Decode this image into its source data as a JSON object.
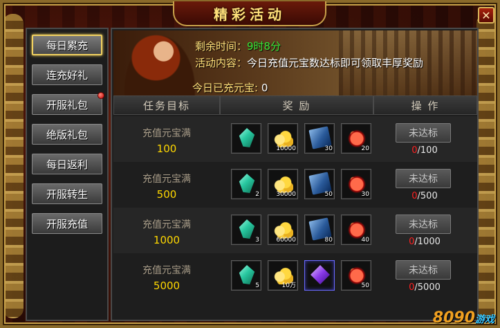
{
  "window": {
    "title": "精彩活动",
    "close_label": "✕"
  },
  "sidebar": {
    "items": [
      {
        "label": "每日累充",
        "active": true,
        "badge": false
      },
      {
        "label": "连充好礼",
        "active": false,
        "badge": false
      },
      {
        "label": "开服礼包",
        "active": false,
        "badge": true
      },
      {
        "label": "绝版礼包",
        "active": false,
        "badge": false
      },
      {
        "label": "每日返利",
        "active": false,
        "badge": false
      },
      {
        "label": "开服转生",
        "active": false,
        "badge": false
      },
      {
        "label": "开服充值",
        "active": false,
        "badge": false
      }
    ]
  },
  "banner": {
    "time_label": "剩余时间：",
    "time_value": "9时8分",
    "content_label": "活动内容：",
    "content_value": "今日充值元宝数达标即可领取丰厚奖励",
    "today_label": "今日已充元宝:",
    "today_value": "0"
  },
  "table": {
    "headers": {
      "target": "任务目标",
      "reward": "奖 励",
      "action": "操 作"
    },
    "rows": [
      {
        "cond": "充值元宝满",
        "amount": "100",
        "items": [
          {
            "icon": "crystal-icon",
            "qty": ""
          },
          {
            "icon": "gold-icon",
            "qty": "10000"
          },
          {
            "icon": "book-icon",
            "qty": "30"
          },
          {
            "icon": "ruby-icon",
            "qty": "20"
          }
        ],
        "button": "未达标",
        "cur": "0",
        "goal": "/100"
      },
      {
        "cond": "充值元宝满",
        "amount": "500",
        "items": [
          {
            "icon": "crystal-icon",
            "qty": "2"
          },
          {
            "icon": "gold-icon",
            "qty": "30000"
          },
          {
            "icon": "book-icon",
            "qty": "50"
          },
          {
            "icon": "ruby-icon",
            "qty": "30"
          }
        ],
        "button": "未达标",
        "cur": "0",
        "goal": "/500"
      },
      {
        "cond": "充值元宝满",
        "amount": "1000",
        "items": [
          {
            "icon": "crystal-icon",
            "qty": "3"
          },
          {
            "icon": "gold-icon",
            "qty": "60000"
          },
          {
            "icon": "book-icon",
            "qty": "80"
          },
          {
            "icon": "ruby-icon",
            "qty": "40"
          }
        ],
        "button": "未达标",
        "cur": "0",
        "goal": "/1000"
      },
      {
        "cond": "充值元宝满",
        "amount": "5000",
        "items": [
          {
            "icon": "crystal-icon",
            "qty": "5"
          },
          {
            "icon": "gold-icon",
            "qty": "10万"
          },
          {
            "icon": "purple-gem-icon",
            "qty": ""
          },
          {
            "icon": "ruby-icon",
            "qty": "50"
          }
        ],
        "button": "未达标",
        "cur": "0",
        "goal": "/5000"
      }
    ]
  },
  "watermark": {
    "brand": "8090",
    "sub": "游戏"
  }
}
